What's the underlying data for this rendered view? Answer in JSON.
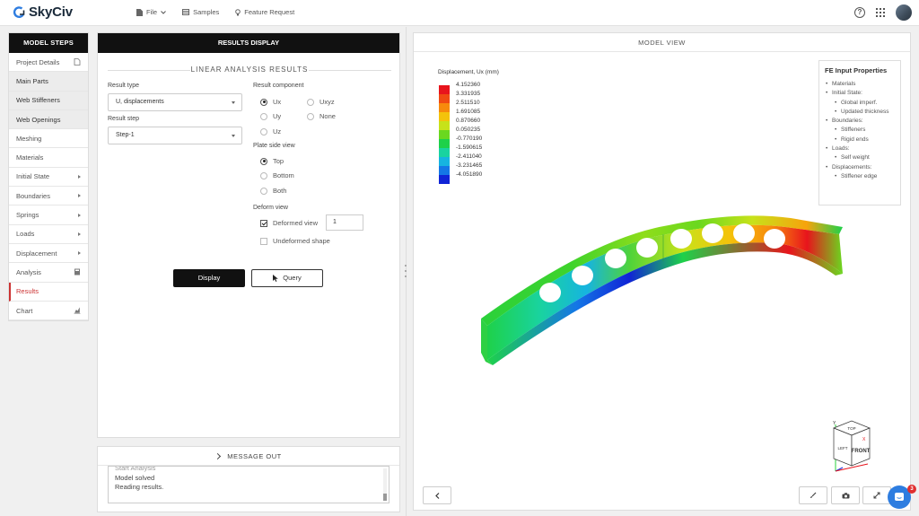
{
  "app": {
    "name": "SkyCiv"
  },
  "topnav": {
    "file": "File",
    "samples": "Samples",
    "feature_request": "Feature Request"
  },
  "steps": {
    "header": "MODEL STEPS",
    "items": [
      {
        "label": "Project Details",
        "icon": "document-icon"
      },
      {
        "label": "Main Parts"
      },
      {
        "label": "Web Stiffeners"
      },
      {
        "label": "Web Openings"
      },
      {
        "label": "Meshing"
      },
      {
        "label": "Materials"
      },
      {
        "label": "Initial State",
        "icon": "caret-right-icon"
      },
      {
        "label": "Boundaries",
        "icon": "caret-right-icon"
      },
      {
        "label": "Springs",
        "icon": "caret-right-icon"
      },
      {
        "label": "Loads",
        "icon": "caret-right-icon"
      },
      {
        "label": "Displacement",
        "icon": "caret-right-icon"
      },
      {
        "label": "Analysis",
        "icon": "calculator-icon"
      },
      {
        "label": "Results",
        "active": true
      },
      {
        "label": "Chart",
        "icon": "chart-icon"
      }
    ]
  },
  "results": {
    "header": "RESULTS DISPLAY",
    "section_title": "LINEAR ANALYSIS RESULTS",
    "result_type_label": "Result type",
    "result_type_value": "U, displacements",
    "result_step_label": "Result step",
    "result_step_value": "Step-1",
    "result_component_label": "Result component",
    "components": [
      "Ux",
      "Uxyz",
      "Uy",
      "None",
      "Uz"
    ],
    "selected_component": "Ux",
    "plate_side_label": "Plate side view",
    "plate_sides": [
      "Top",
      "Bottom",
      "Both"
    ],
    "selected_side": "Top",
    "deform_label": "Deform view",
    "deformed_view_label": "Deformed view",
    "deformed_view_checked": true,
    "deform_scale": "1",
    "undeformed_label": "Undeformed shape",
    "undeformed_checked": false,
    "display_button": "Display",
    "query_button": "Query"
  },
  "message_out": {
    "header": "MESSAGE OUT",
    "lines": [
      "Start Analysis",
      "Model solved",
      "Reading results."
    ]
  },
  "model_view": {
    "header": "MODEL VIEW",
    "legend_title": "Displacement, Ux (mm)",
    "legend_values": [
      "4.152360",
      "3.331935",
      "2.511510",
      "1.691085",
      "0.870660",
      "0.050235",
      "-0.770190",
      "-1.590615",
      "-2.411040",
      "-3.231465",
      "-4.051890"
    ],
    "legend_colors": [
      "#e8141c",
      "#f04a12",
      "#f78a0c",
      "#f4c30b",
      "#c7e21a",
      "#6ad81f",
      "#1ed14a",
      "#19d3a0",
      "#16b4e0",
      "#1477e6",
      "#1024d6"
    ],
    "fe_box": {
      "title": "FE Input Properties",
      "items": [
        {
          "text": "Materials",
          "sub": false
        },
        {
          "text": "Initial State:",
          "sub": false
        },
        {
          "text": "Global imperf.",
          "sub": true
        },
        {
          "text": "Updated thickness",
          "sub": true
        },
        {
          "text": "Boundaries:",
          "sub": false
        },
        {
          "text": "Stiffeners",
          "sub": true
        },
        {
          "text": "Rigid ends",
          "sub": true
        },
        {
          "text": "Loads:",
          "sub": false
        },
        {
          "text": "Self weight",
          "sub": true
        },
        {
          "text": "Displacements:",
          "sub": false
        },
        {
          "text": "Stiffener edge",
          "sub": true
        }
      ]
    },
    "view_cube": {
      "top": "TOP",
      "front": "FRONT",
      "right": "LEFT",
      "axis_y": "Y",
      "axis_x": "X"
    }
  },
  "chat": {
    "badge": "3"
  },
  "colors": {
    "accent": "#c33333",
    "brand_blue": "#2e7de0",
    "dark": "#111111"
  }
}
